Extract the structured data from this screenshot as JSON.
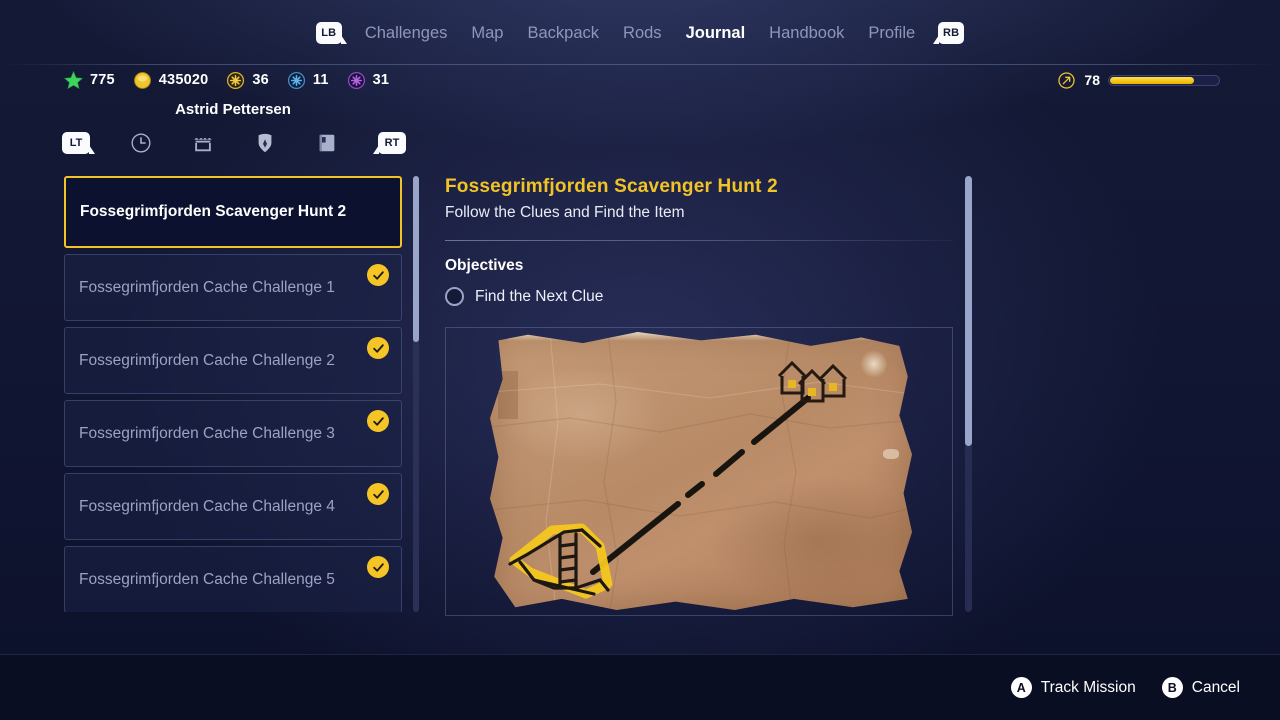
{
  "nav": {
    "left_bumper": "LB",
    "right_bumper": "RB",
    "items": [
      {
        "label": "Challenges",
        "active": false
      },
      {
        "label": "Map",
        "active": false
      },
      {
        "label": "Backpack",
        "active": false
      },
      {
        "label": "Rods",
        "active": false
      },
      {
        "label": "Journal",
        "active": true
      },
      {
        "label": "Handbook",
        "active": false
      },
      {
        "label": "Profile",
        "active": false
      }
    ]
  },
  "currencies": [
    {
      "icon": "green-star-icon",
      "value": "775",
      "color": "#4ddb6a"
    },
    {
      "icon": "gold-coin-icon",
      "value": "435020",
      "color": "#f2c931"
    },
    {
      "icon": "gold-gem-icon",
      "value": "36",
      "color": "#f0c22c"
    },
    {
      "icon": "blue-gem-icon",
      "value": "11",
      "color": "#46a6e8"
    },
    {
      "icon": "purple-gem-icon",
      "value": "31",
      "color": "#a455e0"
    }
  ],
  "xp": {
    "icon": "level-badge-icon",
    "level": "78",
    "fill_percent": 76,
    "bar_color": "#f5c518"
  },
  "player": {
    "name": "Astrid Pettersen"
  },
  "categories": {
    "left_trigger": "LT",
    "right_trigger": "RT",
    "icons": [
      "clock-icon",
      "shop-icon",
      "shield-icon",
      "book-icon"
    ]
  },
  "missions": [
    {
      "label": "Fossegrimfjorden Scavenger Hunt 2",
      "selected": true,
      "completed": false
    },
    {
      "label": "Fossegrimfjorden Cache Challenge 1",
      "selected": false,
      "completed": true
    },
    {
      "label": "Fossegrimfjorden Cache Challenge 2",
      "selected": false,
      "completed": true
    },
    {
      "label": "Fossegrimfjorden Cache Challenge 3",
      "selected": false,
      "completed": true
    },
    {
      "label": "Fossegrimfjorden Cache Challenge 4",
      "selected": false,
      "completed": true
    },
    {
      "label": "Fossegrimfjorden Cache Challenge 5",
      "selected": false,
      "completed": true
    }
  ],
  "detail": {
    "title": "Fossegrimfjorden Scavenger Hunt 2",
    "subtitle": "Follow the Clues and Find the Item",
    "objectives_header": "Objectives",
    "objectives": [
      {
        "text": "Find the Next Clue",
        "complete": false
      }
    ],
    "clue_image": "treasure-map-parchment"
  },
  "footer": {
    "actions": [
      {
        "button": "A",
        "label": "Track Mission"
      },
      {
        "button": "B",
        "label": "Cancel"
      }
    ]
  }
}
